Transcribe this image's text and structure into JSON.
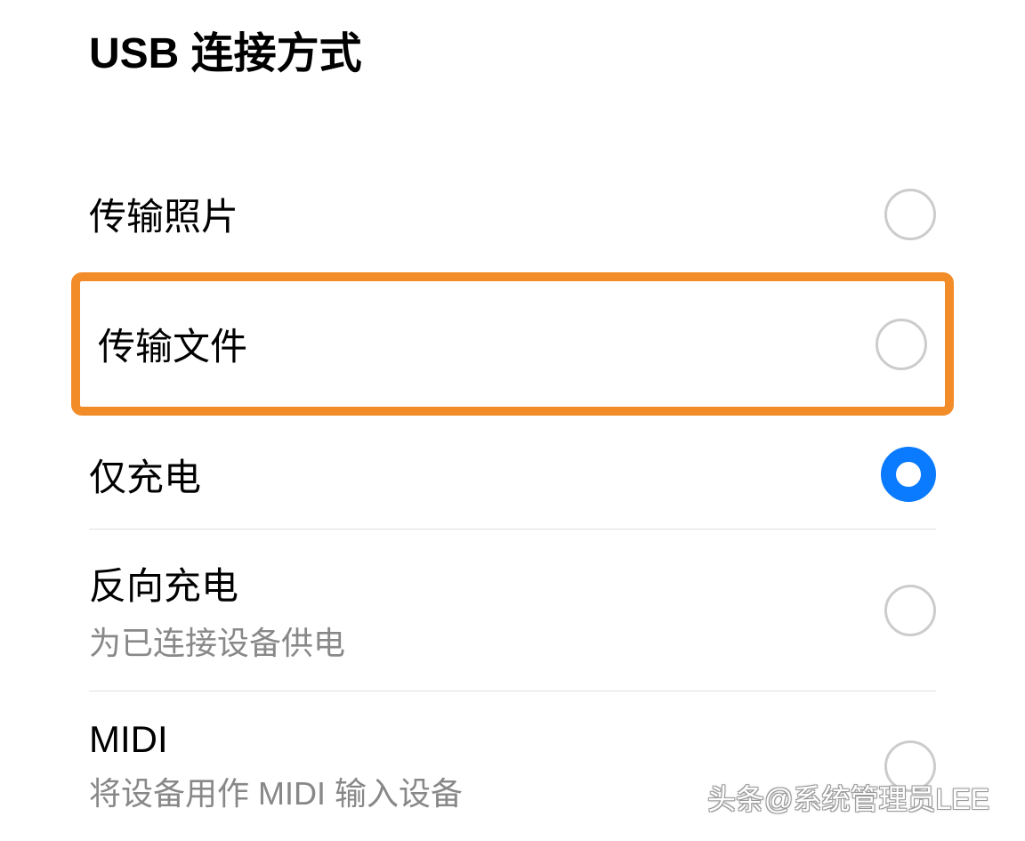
{
  "header": {
    "title": "USB 连接方式"
  },
  "options": [
    {
      "label": "传输照片",
      "sublabel": "",
      "selected": false,
      "highlighted": false,
      "divider_after": false
    },
    {
      "label": "传输文件",
      "sublabel": "",
      "selected": false,
      "highlighted": true,
      "divider_after": false
    },
    {
      "label": "仅充电",
      "sublabel": "",
      "selected": true,
      "highlighted": false,
      "divider_after": true
    },
    {
      "label": "反向充电",
      "sublabel": "为已连接设备供电",
      "selected": false,
      "highlighted": false,
      "divider_after": true
    },
    {
      "label": "MIDI",
      "sublabel": "将设备用作 MIDI 输入设备",
      "selected": false,
      "highlighted": false,
      "divider_after": false
    }
  ],
  "watermark": "头条@系统管理员LEE"
}
